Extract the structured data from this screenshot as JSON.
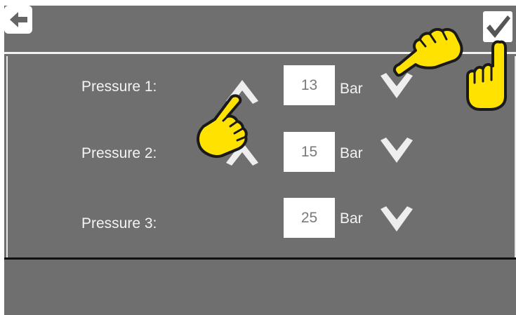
{
  "header": {
    "back_icon": "arrow-left-icon",
    "confirm_icon": "checkmark-icon"
  },
  "pressures": [
    {
      "label": "Pressure 1:",
      "value": "13",
      "unit": "Bar"
    },
    {
      "label": "Pressure 2:",
      "value": "15",
      "unit": "Bar"
    },
    {
      "label": "Pressure 3:",
      "value": "25",
      "unit": "Bar"
    }
  ],
  "colors": {
    "background": "#6f6f6f",
    "hand_fill": "#ffe200",
    "chevron": "#eeeeee"
  }
}
